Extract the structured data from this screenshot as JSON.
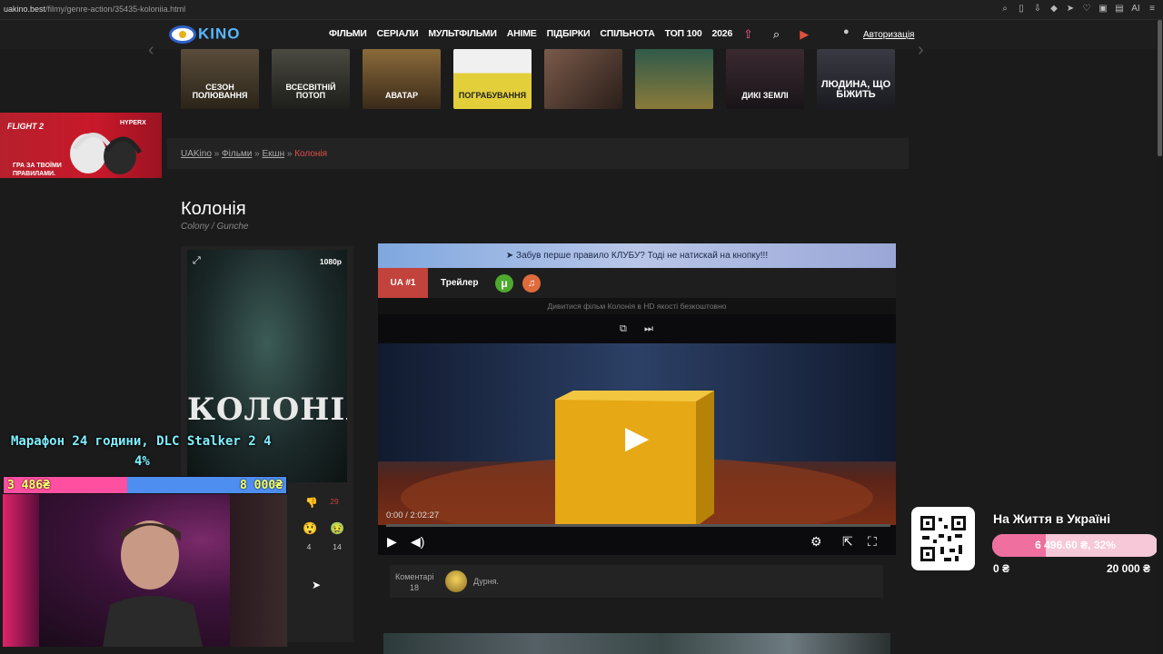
{
  "browser": {
    "url_domain": "uakino.best",
    "url_path": "/filmy/genre-action/35435-koloniia.html",
    "ai_label": "AI"
  },
  "site": {
    "logo_text": "KINO",
    "nav": [
      "ФІЛЬМИ",
      "СЕРІАЛИ",
      "МУЛЬТФІЛЬМИ",
      "АНІМЕ",
      "ПІДБІРКИ",
      "СПІЛЬНОТА",
      "ТОП 100",
      "2026"
    ],
    "login": "Авторизація"
  },
  "slider": {
    "posters": [
      {
        "title": "СЕЗОН ПОЛЮВАННЯ",
        "bg": "#4a4030"
      },
      {
        "title": "ВСЕСВІТНІЙ ПОТОП",
        "bg": "#3a3a33"
      },
      {
        "title": "АВАТАР",
        "bg": "#6b4a2a"
      },
      {
        "title": "ПОГРАБУВАННЯ",
        "bg": "#d8c43a"
      },
      {
        "title": "",
        "bg": "#4d3c34"
      },
      {
        "title": "",
        "bg": "#6a6a3a"
      },
      {
        "title": "ДИКІ ЗЕМЛІ",
        "bg": "#2a2226"
      },
      {
        "title": "ЛЮДИНА, ЩО БІЖИТЬ",
        "bg": "#2f2f33"
      }
    ]
  },
  "breadcrumb": {
    "home": "UAKino",
    "sep": "»",
    "films": "Фільми",
    "genre": "Екшн",
    "current": "Колонія"
  },
  "ad": {
    "brand": "HYPERX",
    "product": "FLIGHT 2",
    "slogan": "ГРА ЗА ТВОЇМИ ПРАВИЛАМИ."
  },
  "movie": {
    "title": "Колонія",
    "original": "Colony / Gunche",
    "poster_title": "КОЛОНІЯ",
    "quality": "1080p",
    "dislikes": "29",
    "react1": "4",
    "react2": "14"
  },
  "player": {
    "banner": "Забув перше правило КЛУБУ? Тоді не натискай на кнопку!!!",
    "tab_ua": "UA #1",
    "tab_trailer": "Трейлер",
    "caption": "Дивитися фільм Колонія в HD якості безкоштовно",
    "time": "0:00 / 2:02:27",
    "progress": 0.0
  },
  "comments": {
    "label": "Коментарі",
    "count": "18",
    "text": "Дурня."
  },
  "stream": {
    "marathon": "Марафон 24 години, DLC Stalker 2 4",
    "marathon_pct": "4%",
    "goal_current": "3 486₴",
    "goal_max": "8 000₴",
    "goal_fraction": 0.4358
  },
  "donation": {
    "title": "На Життя в Україні",
    "bar_text": "6 496.60 ₴, 32%",
    "fraction": 0.32,
    "min": "0 ₴",
    "max": "20 000 ₴"
  }
}
